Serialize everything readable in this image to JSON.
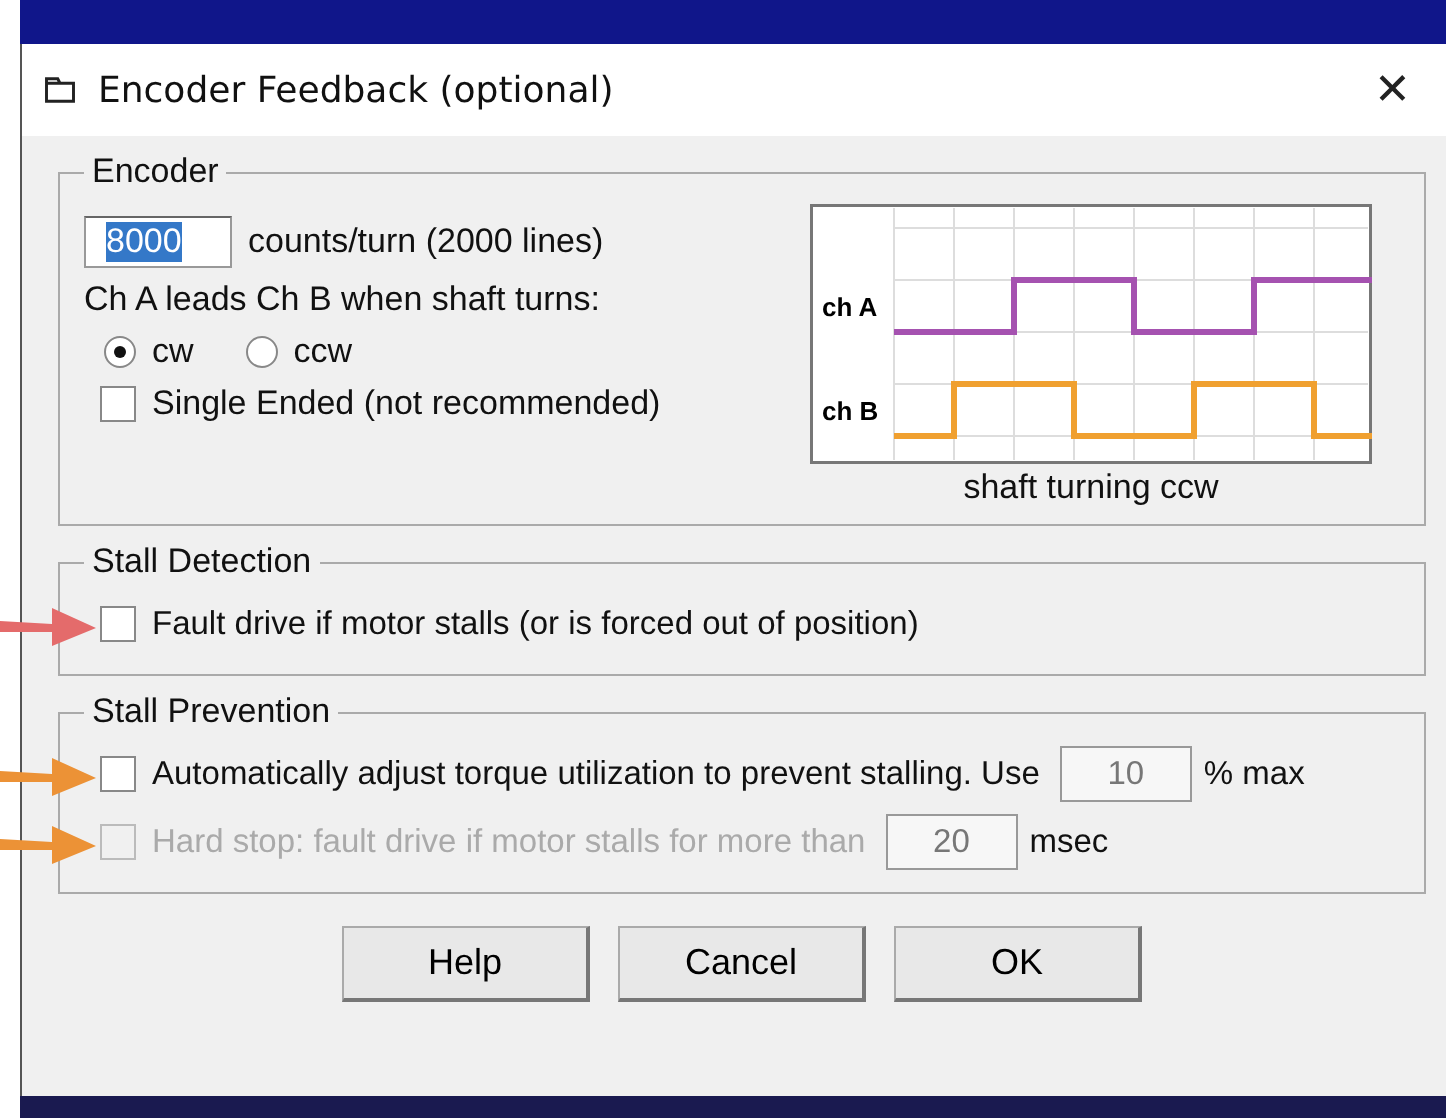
{
  "window": {
    "title": "Encoder Feedback (optional)",
    "close": "✕"
  },
  "encoder": {
    "title": "Encoder",
    "counts": {
      "value": "8000",
      "selected": true
    },
    "counts_label": "counts/turn (2000 lines)",
    "direction_label": "Ch A leads Ch B when shaft turns:",
    "directions": [
      {
        "label": "cw",
        "selected": true
      },
      {
        "label": "ccw",
        "selected": false
      }
    ],
    "single_ended": {
      "label": "Single Ended (not recommended)",
      "checked": false
    },
    "waveform": {
      "channels": [
        {
          "label": "ch A",
          "color": "#a552b0"
        },
        {
          "label": "ch B",
          "color": "#f0a030"
        }
      ],
      "caption": "shaft turning ccw"
    }
  },
  "stall_detection": {
    "title": "Stall Detection",
    "options": [
      {
        "kind": "checkbox",
        "label": "Fault drive if motor stalls (or is forced out of position)",
        "checked": false,
        "disabled": false,
        "arrow": {
          "color": "#e46b6b"
        }
      }
    ]
  },
  "stall_prevention": {
    "title": "Stall Prevention",
    "options": [
      {
        "kind": "value",
        "label": "Automatically adjust torque utilization to prevent stalling. Use",
        "checked": false,
        "disabled": false,
        "value": "10",
        "unit": "% max",
        "arrow": {
          "color": "#ec9236"
        }
      },
      {
        "kind": "value",
        "label": "Hard stop: fault drive if motor stalls for more than",
        "checked": false,
        "disabled": true,
        "value": "20",
        "unit": "msec",
        "arrow": {
          "color": "#ec9236"
        }
      }
    ]
  },
  "buttons": [
    "Help",
    "Cancel",
    "OK"
  ]
}
